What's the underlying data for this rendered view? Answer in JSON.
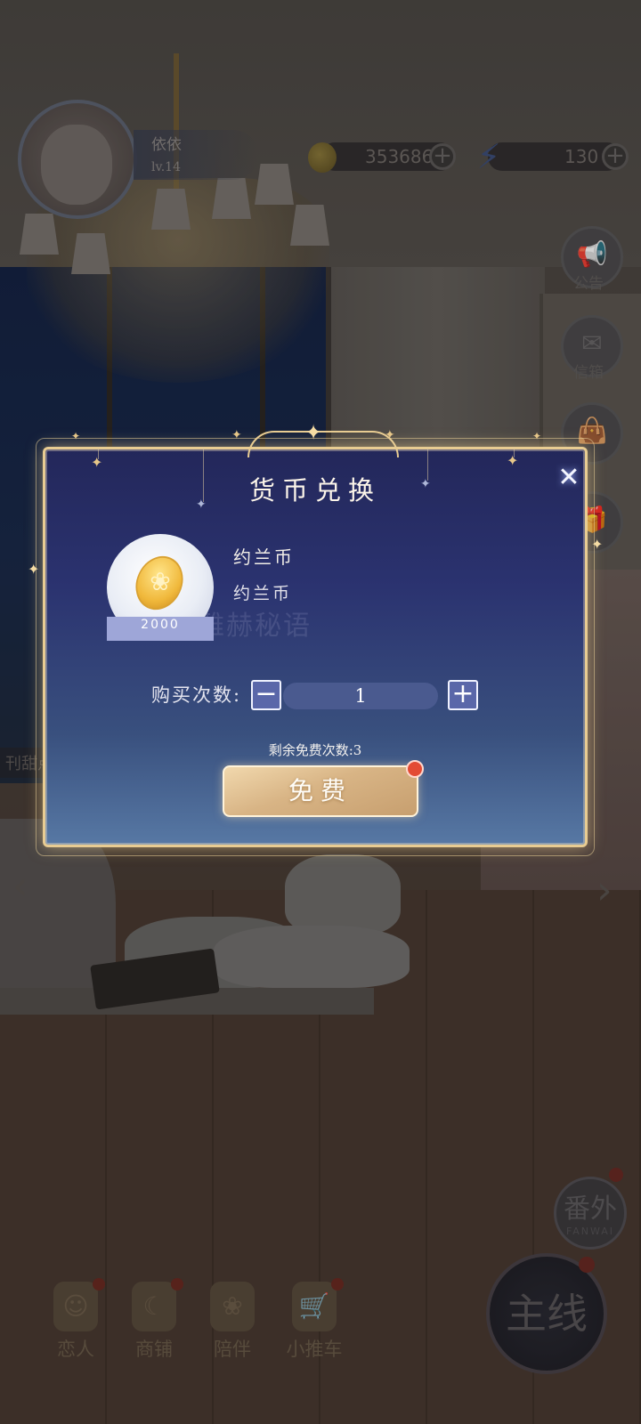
{
  "hud": {
    "player_name": "依依",
    "player_level": "lv.14",
    "coins": "353686",
    "energy": "130"
  },
  "side_menu": {
    "notice": "公告",
    "mail": "信箱",
    "side_tab": "刊甜点"
  },
  "bottom_nav": [
    {
      "label": "恋人",
      "icon": "lover-icon"
    },
    {
      "label": "商铺",
      "icon": "shop-bag-icon"
    },
    {
      "label": "陪伴",
      "icon": "hamster-icon"
    },
    {
      "label": "小推车",
      "icon": "cart-icon"
    }
  ],
  "fanwai": {
    "label_cn": "番外",
    "label_en": "FANWAI"
  },
  "mainline": {
    "label": "主线"
  },
  "dialog": {
    "title": "货币兑换",
    "item_name": "约兰币",
    "item_desc": "约兰币",
    "coin_amount": "2000",
    "qty_label": "购买次数:",
    "qty_value": "1",
    "minus": "−",
    "plus": "+",
    "remaining": "剩余免费次数:3",
    "free_button": "免费",
    "watermark": "雅赫秘语"
  },
  "colors": {
    "dialog_top": "#23275a",
    "dialog_bottom": "#5778a4",
    "gold_border": "#e8cc92",
    "free_button": "#d8b485",
    "badge_red": "#e34b34"
  }
}
